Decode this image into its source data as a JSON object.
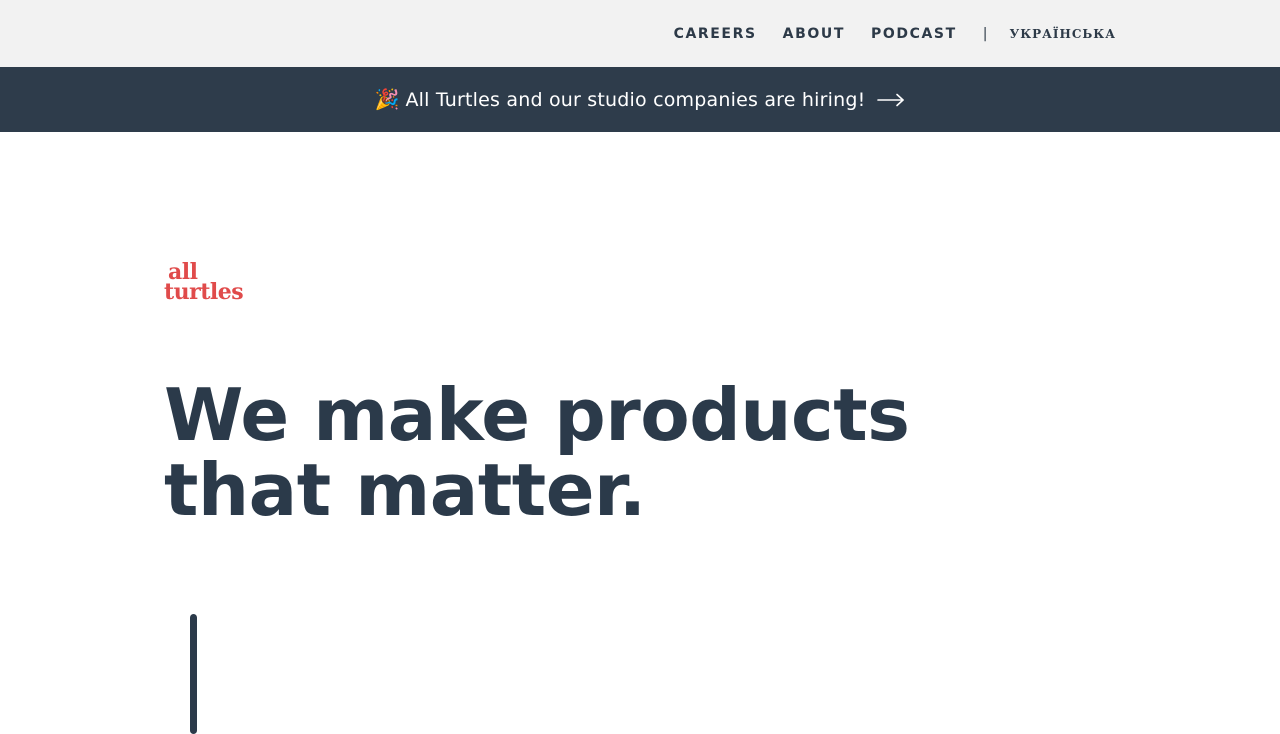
{
  "nav": {
    "links": [
      "CAREERS",
      "ABOUT",
      "PODCAST"
    ],
    "separator": "|",
    "language": "УКРАЇНСЬКА"
  },
  "banner": {
    "emoji": "🎉",
    "text": "All Turtles and our studio companies are hiring!",
    "arrow_icon": "arrow-right-icon",
    "background": "#2e3c4b"
  },
  "logo": {
    "line1": "all",
    "line2": "turtles",
    "color": "#e04b4b"
  },
  "hero": {
    "headline_line1": "We make products",
    "headline_line2": "that matter."
  },
  "colors": {
    "nav_bg": "#f2f2f2",
    "text_dark": "#2b3a4a",
    "accent": "#e04b4b"
  }
}
